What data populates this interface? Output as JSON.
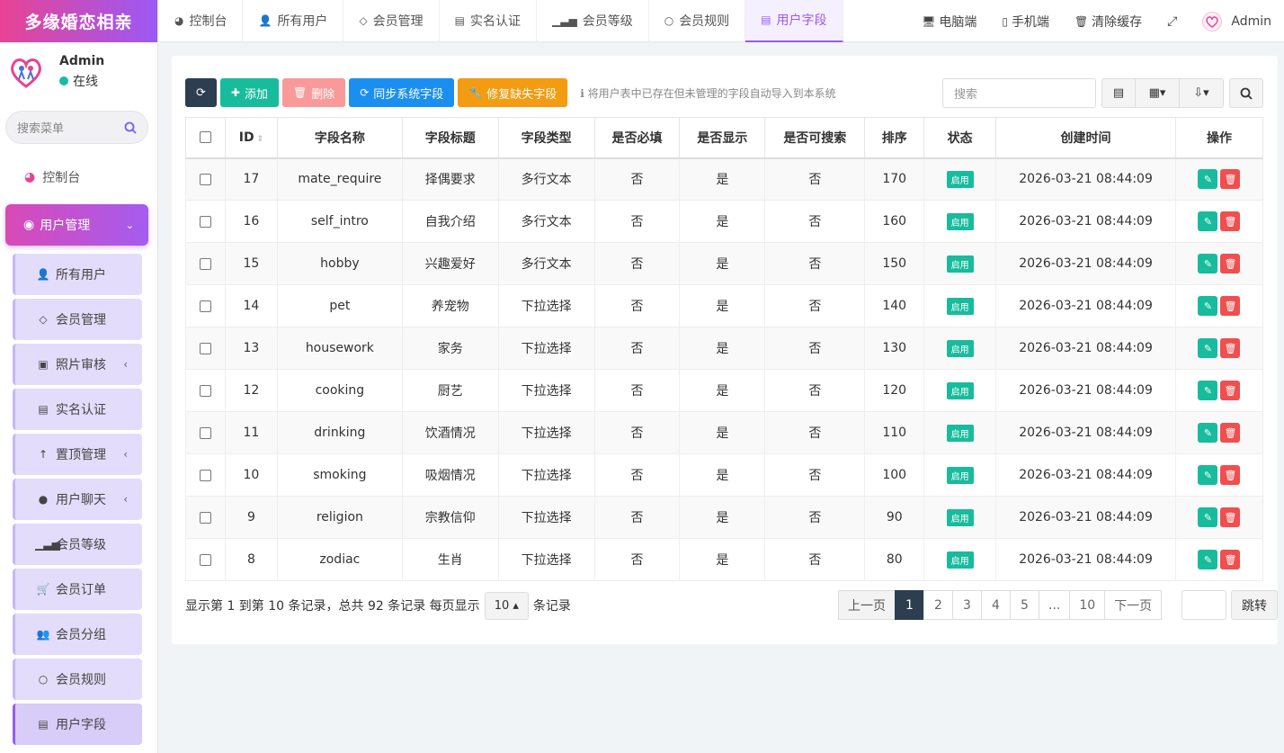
{
  "app": {
    "logo_text": "多缘婚恋相亲",
    "brand_color": "#e84393",
    "accent_color": "#9b59f6"
  },
  "user_panel": {
    "name": "Admin",
    "status": "在线"
  },
  "sidebar": {
    "search_placeholder": "搜索菜单",
    "dashboard": "控制台",
    "group": "用户管理",
    "items": [
      {
        "label": "所有用户",
        "icon": "user-icon"
      },
      {
        "label": "会员管理",
        "icon": "diamond-icon"
      },
      {
        "label": "照片审核",
        "icon": "image-icon"
      },
      {
        "label": "实名认证",
        "icon": "id-card-icon"
      },
      {
        "label": "置顶管理",
        "icon": "arrow-up-icon"
      },
      {
        "label": "用户聊天",
        "icon": "chat-icon"
      },
      {
        "label": "会员等级",
        "icon": "signal-icon"
      },
      {
        "label": "会员订单",
        "icon": "cart-icon"
      },
      {
        "label": "会员分组",
        "icon": "users-icon"
      },
      {
        "label": "会员规则",
        "icon": "circle-icon"
      },
      {
        "label": "用户字段",
        "icon": "list-icon"
      }
    ]
  },
  "tabs": [
    {
      "label": "控制台",
      "icon": "dashboard-icon"
    },
    {
      "label": "所有用户",
      "icon": "user-icon"
    },
    {
      "label": "会员管理",
      "icon": "diamond-icon"
    },
    {
      "label": "实名认证",
      "icon": "id-card-icon"
    },
    {
      "label": "会员等级",
      "icon": "signal-icon"
    },
    {
      "label": "会员规则",
      "icon": "circle-icon"
    },
    {
      "label": "用户字段",
      "icon": "list-icon"
    }
  ],
  "topnav": {
    "desktop": "电脑端",
    "mobile": "手机端",
    "clear_cache": "清除缓存",
    "admin": "Admin"
  },
  "toolbar": {
    "add": "添加",
    "delete": "删除",
    "sync": "同步系统字段",
    "repair": "修复缺失字段",
    "tip": "将用户表中已存在但未管理的字段自动导入到本系统",
    "search_placeholder": "搜索"
  },
  "table": {
    "headers": [
      "ID",
      "字段名称",
      "字段标题",
      "字段类型",
      "是否必填",
      "是否显示",
      "是否可搜索",
      "排序",
      "状态",
      "创建时间",
      "操作"
    ],
    "rows": [
      {
        "id": "17",
        "name": "mate_require",
        "title": "择偶要求",
        "type": "多行文本",
        "required": "否",
        "visible": "是",
        "searchable": "否",
        "sort": "170",
        "status": "启用",
        "created": "2026-03-21 08:44:09"
      },
      {
        "id": "16",
        "name": "self_intro",
        "title": "自我介绍",
        "type": "多行文本",
        "required": "否",
        "visible": "是",
        "searchable": "否",
        "sort": "160",
        "status": "启用",
        "created": "2026-03-21 08:44:09"
      },
      {
        "id": "15",
        "name": "hobby",
        "title": "兴趣爱好",
        "type": "多行文本",
        "required": "否",
        "visible": "是",
        "searchable": "否",
        "sort": "150",
        "status": "启用",
        "created": "2026-03-21 08:44:09"
      },
      {
        "id": "14",
        "name": "pet",
        "title": "养宠物",
        "type": "下拉选择",
        "required": "否",
        "visible": "是",
        "searchable": "否",
        "sort": "140",
        "status": "启用",
        "created": "2026-03-21 08:44:09"
      },
      {
        "id": "13",
        "name": "housework",
        "title": "家务",
        "type": "下拉选择",
        "required": "否",
        "visible": "是",
        "searchable": "否",
        "sort": "130",
        "status": "启用",
        "created": "2026-03-21 08:44:09"
      },
      {
        "id": "12",
        "name": "cooking",
        "title": "厨艺",
        "type": "下拉选择",
        "required": "否",
        "visible": "是",
        "searchable": "否",
        "sort": "120",
        "status": "启用",
        "created": "2026-03-21 08:44:09"
      },
      {
        "id": "11",
        "name": "drinking",
        "title": "饮酒情况",
        "type": "下拉选择",
        "required": "否",
        "visible": "是",
        "searchable": "否",
        "sort": "110",
        "status": "启用",
        "created": "2026-03-21 08:44:09"
      },
      {
        "id": "10",
        "name": "smoking",
        "title": "吸烟情况",
        "type": "下拉选择",
        "required": "否",
        "visible": "是",
        "searchable": "否",
        "sort": "100",
        "status": "启用",
        "created": "2026-03-21 08:44:09"
      },
      {
        "id": "9",
        "name": "religion",
        "title": "宗教信仰",
        "type": "下拉选择",
        "required": "否",
        "visible": "是",
        "searchable": "否",
        "sort": "90",
        "status": "启用",
        "created": "2026-03-21 08:44:09"
      },
      {
        "id": "8",
        "name": "zodiac",
        "title": "生肖",
        "type": "下拉选择",
        "required": "否",
        "visible": "是",
        "searchable": "否",
        "sort": "80",
        "status": "启用",
        "created": "2026-03-21 08:44:09"
      }
    ]
  },
  "pagination": {
    "info": "显示第 1 到第 10 条记录，总共 92 条记录 每页显示",
    "page_size": "10",
    "suffix": "条记录",
    "prev": "上一页",
    "next": "下一页",
    "pages": [
      "1",
      "2",
      "3",
      "4",
      "5",
      "...",
      "10"
    ],
    "jump": "跳转"
  }
}
